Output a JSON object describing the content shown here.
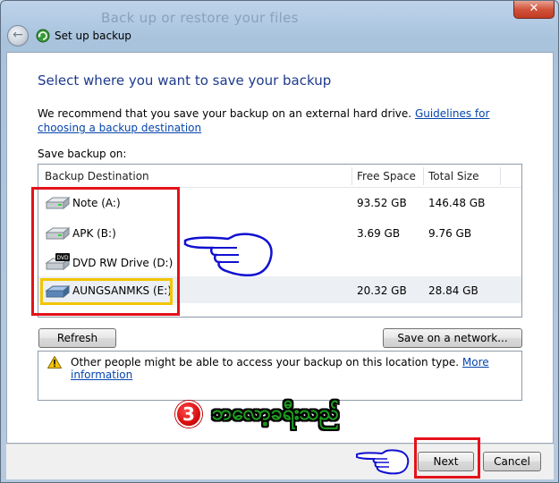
{
  "window": {
    "title": "Back up or restore your files",
    "close_glyph": "✕"
  },
  "header": {
    "title": "Set up backup",
    "back_icon": "back-arrow-icon"
  },
  "main": {
    "heading": "Select where you want to save your backup",
    "recommend_text": "We recommend that you save your backup on an external hard drive.",
    "guidelines_link": "Guidelines for choosing a backup destination",
    "save_on_label": "Save backup on:",
    "columns": {
      "destination": "Backup Destination",
      "free": "Free Space",
      "total": "Total Size"
    },
    "drives": [
      {
        "name": "Note (A:)",
        "free": "93.52 GB",
        "total": "146.48 GB",
        "icon": "hard-drive-icon"
      },
      {
        "name": "APK (B:)",
        "free": "3.69 GB",
        "total": "9.76 GB",
        "icon": "hard-drive-icon"
      },
      {
        "name": "DVD RW Drive (D:)",
        "free": "",
        "total": "",
        "icon": "dvd-drive-icon"
      },
      {
        "name": "AUNGSANMKS (E:)",
        "free": "20.32 GB",
        "total": "28.84 GB",
        "icon": "usb-drive-icon",
        "selected": true
      }
    ],
    "dvd_label": "DVD",
    "refresh_label": "Refresh",
    "network_label": "Save on a network...",
    "warning_text": "Other people might be able to access your backup on this location type.",
    "more_info_link": "More information"
  },
  "annotation": {
    "step_number": "3",
    "burmese_text": "ဘလော့ခရီးသည်",
    "red": "#e4121a",
    "yellow": "#f2c500"
  },
  "footer": {
    "next_label": "Next",
    "cancel_label": "Cancel"
  }
}
